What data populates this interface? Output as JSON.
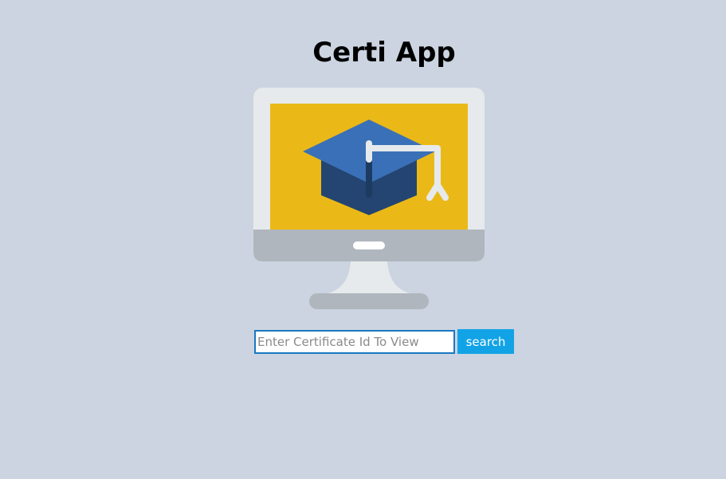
{
  "app": {
    "title": "Certi App"
  },
  "hero": {
    "icon": "monitor-graduation-cap-icon"
  },
  "search": {
    "placeholder": "Enter Certificate Id To View",
    "value": "",
    "button_label": "search"
  },
  "colors": {
    "background": "#cbd4e0",
    "button": "#12a3e6",
    "input_border": "#1a78c2",
    "screen": "#ebb917",
    "cap": "#3a70b8"
  }
}
